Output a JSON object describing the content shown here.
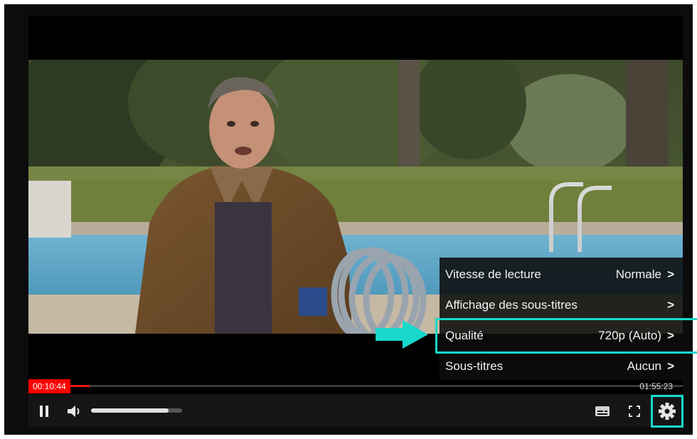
{
  "player": {
    "time_elapsed": "00:10:44",
    "time_total": "01:55:23",
    "progress_fraction": 0.093,
    "volume_fraction": 0.85
  },
  "settings_menu": {
    "items": [
      {
        "label": "Vitesse de lecture",
        "value": "Normale",
        "chevron": ">"
      },
      {
        "label": "Affichage des sous-titres",
        "value": "",
        "chevron": ">"
      },
      {
        "label": "Qualité",
        "value": "720p (Auto)",
        "chevron": ">"
      },
      {
        "label": "Sous-titres",
        "value": "Aucun",
        "chevron": ">"
      }
    ],
    "highlighted_item": "Qualité"
  },
  "colors": {
    "highlight": "#18d9cc",
    "progress": "#e41616",
    "menu_bg": "#0c0c0c"
  },
  "icons": [
    "pause-icon",
    "volume-icon",
    "subtitles-icon",
    "fullscreen-icon",
    "gear-icon",
    "arrow-right-icon"
  ]
}
